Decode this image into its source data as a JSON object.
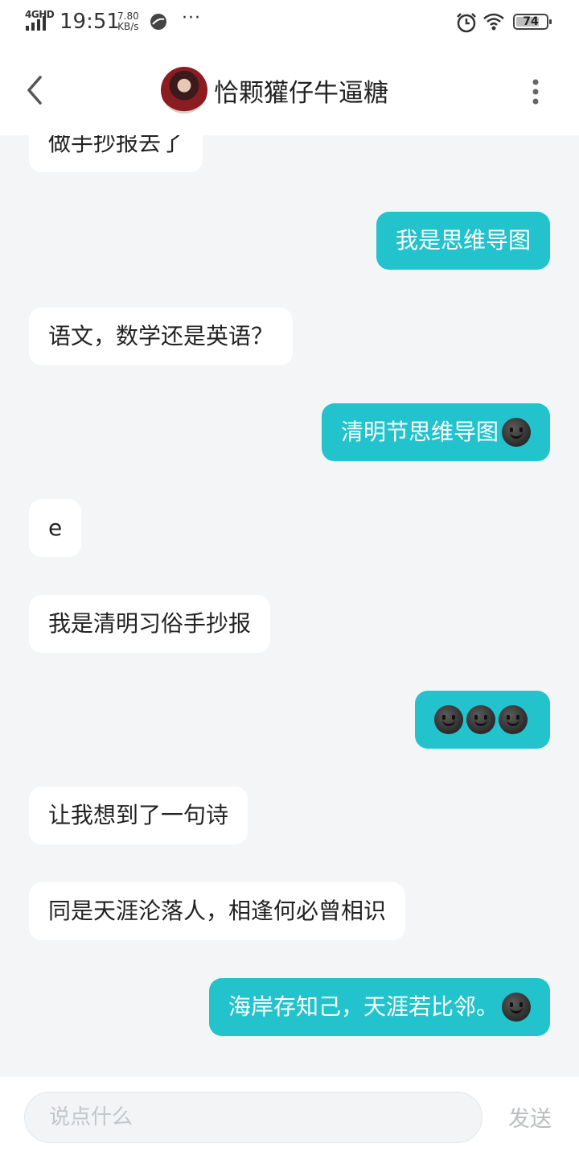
{
  "status_bar": {
    "network": "4GHD",
    "time": "19:51",
    "speed_value": "7.80",
    "speed_unit": "KB/s",
    "more": "···",
    "battery": "74"
  },
  "header": {
    "title": "恰颗獾仔牛逼糖",
    "back_icon": "chevron-left-icon",
    "more_icon": "vertical-dots-icon"
  },
  "messages": [
    {
      "side": "left",
      "text": "做手抄报去了"
    },
    {
      "side": "right",
      "text": "我是思维导图"
    },
    {
      "side": "left",
      "text": "语文，数学还是英语？"
    },
    {
      "side": "right",
      "text": "清明节思维导图",
      "emoji_count": 1
    },
    {
      "side": "left",
      "text": "e"
    },
    {
      "side": "left",
      "text": "我是清明习俗手抄报"
    },
    {
      "side": "right",
      "text": "",
      "emoji_count": 3
    },
    {
      "side": "left",
      "text": "让我想到了一句诗"
    },
    {
      "side": "left",
      "text": "同是天涯沦落人，相逢何必曾相识"
    },
    {
      "side": "right",
      "text": "海岸存知己，天涯若比邻。",
      "emoji_count": 1
    }
  ],
  "input": {
    "placeholder": "说点什么",
    "send_label": "发送"
  },
  "colors": {
    "accent": "#22c3cc",
    "background": "#f3f5f7"
  }
}
